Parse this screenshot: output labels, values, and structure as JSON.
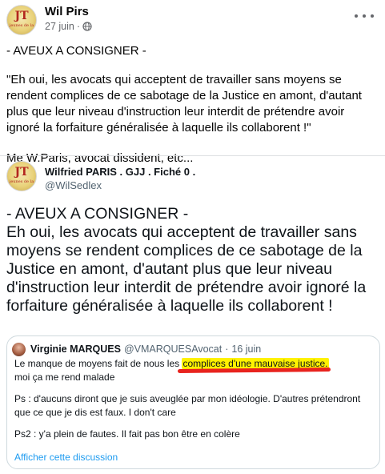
{
  "post": {
    "author": "Wil Pirs",
    "date": "27 juin",
    "separator": "·",
    "avatar_monogram": "JT",
    "avatar_caption": "jeunes de la",
    "paragraphs": [
      "- AVEUX A CONSIGNER -",
      "\"Eh oui, les avocats qui acceptent de travailler sans moyens se rendent complices de ce sabotage de la Justice en amont, d'autant plus que leur niveau d'instruction leur interdit de prétendre avoir ignoré la forfaiture généralisée à laquelle ils collaborent !\"",
      "Me W.Paris, avocat dissident, etc..."
    ],
    "icons": {
      "privacy": "globe-icon",
      "menu": "more-options-icon"
    }
  },
  "tweet": {
    "author": "Wilfried PARIS . GJJ . Fiché 0 .",
    "handle": "@WilSedlex",
    "avatar_monogram": "JT",
    "avatar_caption": "jeunes de la",
    "lines": [
      "- AVEUX A CONSIGNER -",
      "Eh oui, les avocats qui acceptent de travailler sans moyens se rendent complices de ce sabotage de la Justice en amont, d'autant plus que leur niveau d'instruction leur interdit de prétendre avoir ignoré la forfaiture généralisée à laquelle ils collaborent !"
    ]
  },
  "quoted": {
    "author": "Virginie MARQUES",
    "handle": "@VMARQUESAvocat",
    "separator": "·",
    "date": "16 juin",
    "line1_before": "Le manque de moyens fait de nous les ",
    "line1_highlight": "complices d'une mauvaise justice.",
    "line2": "moi ça me rend malade",
    "ps1": "Ps : d'aucuns diront que je suis aveuglée par mon idéologie. D'autres prétendront que ce que je dis est faux. I don't care",
    "ps2": "Ps2 : y'a plein de fautes. Il fait pas bon être en colère",
    "link": "Afficher cette discussion",
    "colors": {
      "highlight": "#fff200",
      "underline": "#e8231e",
      "link": "#1d9bf0"
    }
  }
}
